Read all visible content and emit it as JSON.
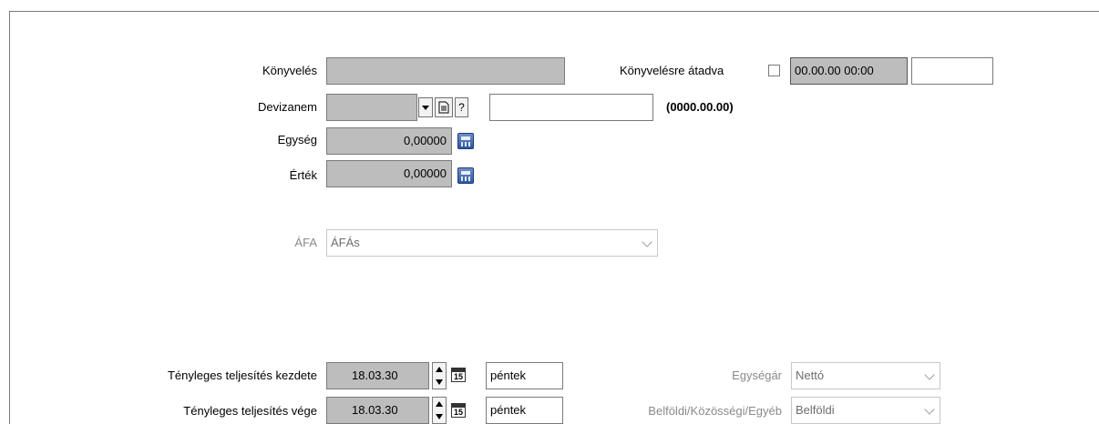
{
  "accounting": {
    "label": "Könyvelés",
    "value": "",
    "transferred_label": "Könyvelésre átadva",
    "transferred_checked": false,
    "transfer_datetime": "00.00.00 00:00",
    "transfer_extra": ""
  },
  "currency": {
    "label": "Devizanem",
    "value": "",
    "help": "?",
    "rate_value": "",
    "rate_date": "(0000.00.00)"
  },
  "unit": {
    "label": "Egység",
    "value": "0,00000"
  },
  "amount": {
    "label": "Érték",
    "value": "0,00000"
  },
  "vat": {
    "label": "ÁFA",
    "value": "ÁFÁs"
  },
  "actual_start": {
    "label": "Tényleges teljesítés kezdete",
    "date": "18.03.30",
    "picker": "15",
    "weekday": "péntek"
  },
  "actual_end": {
    "label": "Tényleges teljesítés vége",
    "date": "18.03.30",
    "picker": "15",
    "weekday": "péntek"
  },
  "unit_price": {
    "label": "Egységár",
    "value": "Nettó"
  },
  "domestic": {
    "label": "Belföldi/Közösségi/Egyéb",
    "value": "Belföldi"
  },
  "icons": {
    "dropdown": "dropdown-arrow-icon",
    "document": "document-icon",
    "calculator": "calculator-icon",
    "calendar": "calendar-icon",
    "spinner": "spinner-icon",
    "chevron": "chevron-down-icon"
  }
}
